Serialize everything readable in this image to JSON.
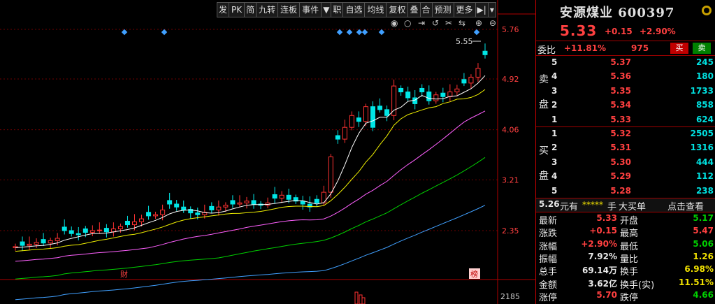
{
  "toolbar": {
    "items": [
      "发",
      "PK",
      "简",
      "九转",
      "连板",
      "事件",
      "",
      "职",
      "自选",
      "均线",
      "复权",
      "叠",
      "合",
      "预测",
      "更多",
      "",
      ""
    ]
  },
  "chart": {
    "y_ticks": [
      "5.76",
      "4.92",
      "4.06",
      "3.21",
      "2.35"
    ],
    "volume_tick": "2185",
    "high_label": "5.55",
    "markers": [
      "财",
      "榜"
    ],
    "icons": [
      "eye-icon",
      "circle-icon",
      "skip-icon",
      "undo-icon",
      "scissors-icon",
      "fit-icon",
      "zoom-in-icon",
      "zoom-out-icon"
    ],
    "colors": {
      "up": "#ff3232",
      "down": "#00e6e6",
      "ma5": "#ffffff",
      "ma10": "#f0f000",
      "ma20": "#ff60ff",
      "ma30": "#00d000",
      "ma60": "#40a0ff"
    }
  },
  "chart_data": {
    "type": "candlestick",
    "y_ticks": [
      5.76,
      4.92,
      4.06,
      3.21,
      2.35
    ],
    "high_label": 5.55,
    "series": [
      {
        "values": [
          2.08,
          2.1,
          2.12,
          2.15,
          2.14,
          2.18,
          2.22,
          2.35,
          2.3,
          2.28,
          2.32,
          2.35,
          2.36,
          2.33,
          2.38,
          2.42,
          2.45,
          2.5,
          2.55,
          2.6,
          2.62,
          2.7,
          2.8,
          2.75,
          2.7,
          2.65,
          2.62,
          2.66,
          2.7,
          2.75,
          2.78,
          2.8,
          2.82,
          2.85,
          2.8,
          2.78,
          2.82,
          2.9,
          2.95,
          2.88,
          2.85,
          2.8,
          2.75,
          2.82,
          3.0,
          3.6,
          3.9,
          4.1,
          4.3,
          4.2,
          4.45,
          4.1,
          4.4,
          4.3,
          4.8,
          4.7,
          4.6,
          4.5,
          4.7,
          4.55,
          4.65,
          4.62,
          4.7,
          4.75,
          4.85,
          4.95,
          5.1,
          5.33
        ]
      }
    ]
  },
  "side": {
    "title": "安源煤业 600397",
    "price": "5.33",
    "change": "+0.15",
    "pct": "+2.90%",
    "wb_label": "委比",
    "wb_value": "+11.81%",
    "wb_count": "975",
    "sell_btn": "买",
    "buy_btn": "卖",
    "sell_label": [
      "卖",
      "盘"
    ],
    "buy_label": [
      "买",
      "盘"
    ],
    "asks": [
      {
        "lvl": "5",
        "price": "5.37",
        "vol": "245"
      },
      {
        "lvl": "4",
        "price": "5.36",
        "vol": "180"
      },
      {
        "lvl": "3",
        "price": "5.35",
        "vol": "1733"
      },
      {
        "lvl": "2",
        "price": "5.34",
        "vol": "858"
      },
      {
        "lvl": "1",
        "price": "5.33",
        "vol": "624"
      }
    ],
    "bids": [
      {
        "lvl": "1",
        "price": "5.32",
        "vol": "2505"
      },
      {
        "lvl": "2",
        "price": "5.31",
        "vol": "1316"
      },
      {
        "lvl": "3",
        "price": "5.30",
        "vol": "444"
      },
      {
        "lvl": "4",
        "price": "5.29",
        "vol": "112"
      },
      {
        "lvl": "5",
        "price": "5.28",
        "vol": "238"
      }
    ],
    "bigbuy": {
      "price": "5.26",
      "unit": "元有",
      "stars": "*****",
      "shou": "手",
      "label": "大买单",
      "link": "点击查看"
    },
    "stats": [
      {
        "k1": "最新",
        "v1": "5.33",
        "k2": "开盘",
        "v2": "5.17"
      },
      {
        "k1": "涨跌",
        "v1": "+0.15",
        "k2": "最高",
        "v2": "5.47"
      },
      {
        "k1": "涨幅",
        "v1": "+2.90%",
        "k2": "最低",
        "v2": "5.06"
      },
      {
        "k1": "振幅",
        "v1": "7.92%",
        "k2": "量比",
        "v2": "1.26"
      },
      {
        "k1": "总手",
        "v1": "69.14万",
        "k2": "换手",
        "v2": "6.98%"
      },
      {
        "k1": "金额",
        "v1": "3.62亿",
        "k2": "换手(实)",
        "v2": "11.51%"
      },
      {
        "k1": "涨停",
        "v1": "5.70",
        "k2": "跌停",
        "v2": "4.66"
      }
    ]
  }
}
